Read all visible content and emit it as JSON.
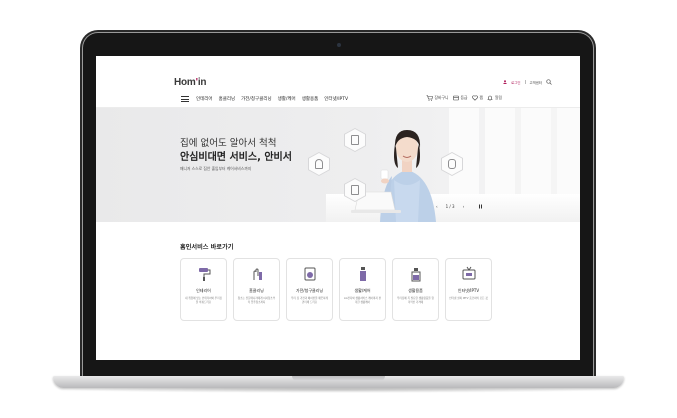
{
  "header": {
    "logo_main": "Hom",
    "logo_apos": "'",
    "logo_tail": "in",
    "util": {
      "login": "로그인",
      "join": "고객센터"
    }
  },
  "gnb": {
    "menu": [
      "인테리어",
      "홈클리닝",
      "가전/청구클리닝",
      "생활/케어",
      "생활용품",
      "인터넷/IPTV"
    ],
    "right": {
      "cart": "장바구니",
      "grade": "등급",
      "like": "찜",
      "alarm": "알림"
    }
  },
  "hero": {
    "title_line1": "집에 없어도 알아서 척척",
    "title_line2": "안심비대면 서비스, 안비서",
    "subtitle": "매니저 스스로 집안 출입부터 케어서비스까지",
    "page_indicator": "1 / 3",
    "prev": "‹",
    "next": "›"
  },
  "services": {
    "title": "홈인서비스 바로가기",
    "cards": [
      {
        "name": "인테리어",
        "desc": "내 취향에 맞는 인테리어와 우리집을 바꿔드려요"
      },
      {
        "name": "홈클리닝",
        "desc": "청소는 전문매니저에게 이사청소부터 입주청소까지"
      },
      {
        "name": "가전/청구클리닝",
        "desc": "우리 집 가전과 에어컨을 깨끗하게 관리해 드려요"
      },
      {
        "name": "생활/케어",
        "desc": "LG전자와 생활서비스 케어까지 편리한 생활케어"
      },
      {
        "name": "생활용품",
        "desc": "우리집에 꼭 필요한 생활용품을 합리적인 가격에"
      },
      {
        "name": "인터넷/IPTV",
        "desc": "인터넷 설치 IPTV 홈코치의 모든 것"
      }
    ]
  },
  "colors": {
    "brand": "#b01e5c",
    "icon_purple": "#7e6aa8",
    "text": "#222222"
  }
}
